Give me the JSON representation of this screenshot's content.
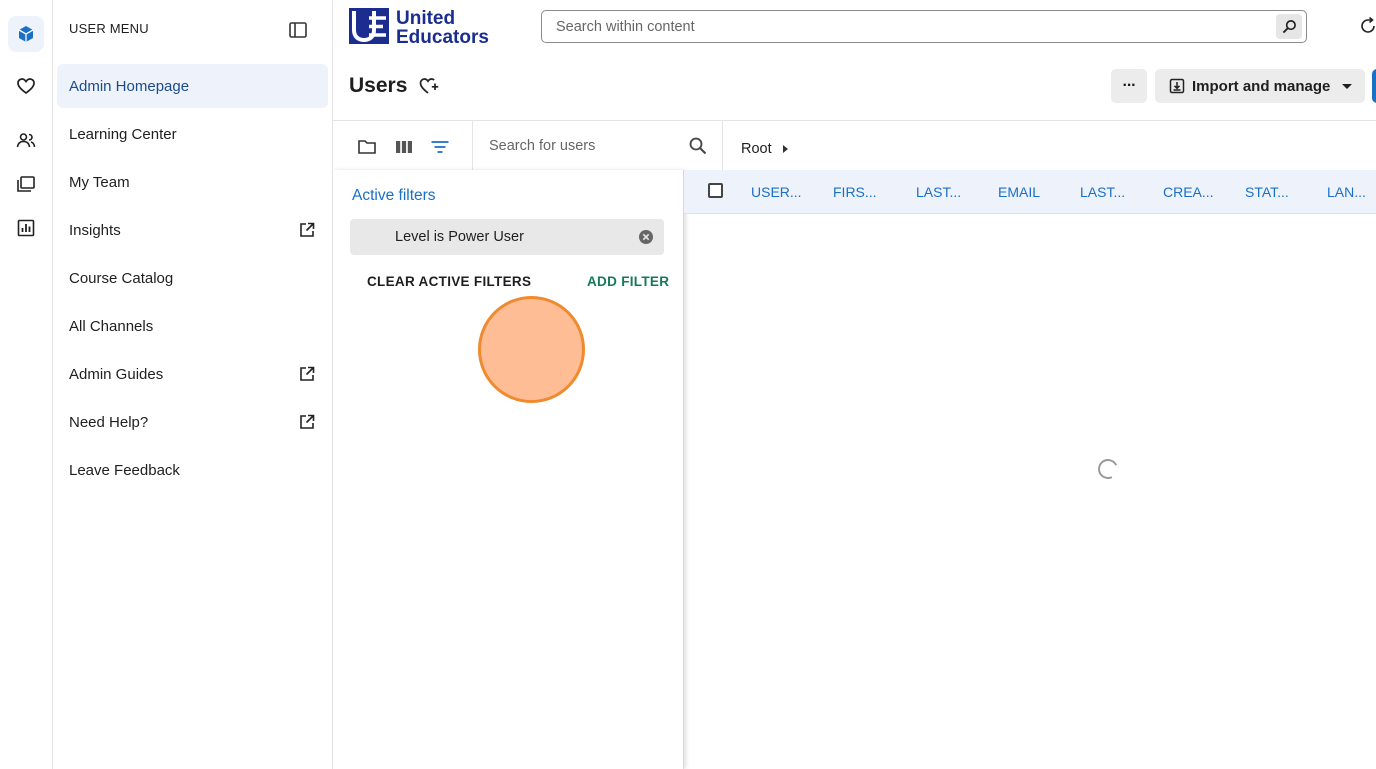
{
  "rail": {
    "items": [
      {
        "name": "cube-icon"
      },
      {
        "name": "heart-icon"
      },
      {
        "name": "people-icon"
      },
      {
        "name": "folders-icon"
      },
      {
        "name": "chart-icon"
      }
    ]
  },
  "sidebar": {
    "header": "USER MENU",
    "items": [
      {
        "label": "Admin Homepage",
        "active": true,
        "external": false
      },
      {
        "label": "Learning Center",
        "active": false,
        "external": false
      },
      {
        "label": "My Team",
        "active": false,
        "external": false
      },
      {
        "label": "Insights",
        "active": false,
        "external": true
      },
      {
        "label": "Course Catalog",
        "active": false,
        "external": false
      },
      {
        "label": "All Channels",
        "active": false,
        "external": false
      },
      {
        "label": "Admin Guides",
        "active": false,
        "external": true
      },
      {
        "label": "Need Help?",
        "active": false,
        "external": true
      },
      {
        "label": "Leave Feedback",
        "active": false,
        "external": false
      }
    ]
  },
  "topbar": {
    "logo": {
      "mark": "UE",
      "line1": "United",
      "line2": "Educators"
    },
    "search_placeholder": "Search within content"
  },
  "page": {
    "title": "Users",
    "more_label": "···",
    "import_label": "Import and manage"
  },
  "toolbar": {
    "search_placeholder": "Search for users",
    "breadcrumb": "Root"
  },
  "filters": {
    "title": "Active filters",
    "chip": "Level is Power User",
    "clear_label": "CLEAR ACTIVE FILTERS",
    "add_label": "ADD FILTER"
  },
  "table": {
    "columns": [
      "USER...",
      "FIRS...",
      "LAST...",
      "EMAIL",
      "LAST...",
      "CREA...",
      "STAT...",
      "LAN..."
    ]
  },
  "colors": {
    "accent": "#1a6fc7",
    "active_bg": "#eef3fb",
    "add_filter": "#157a5a",
    "click_indicator": "#f08a2e"
  }
}
